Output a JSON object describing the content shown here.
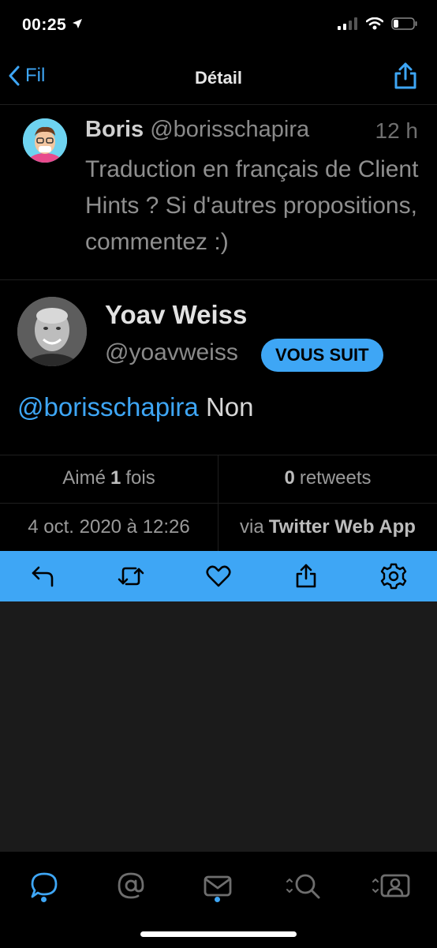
{
  "status": {
    "time": "00:25"
  },
  "nav": {
    "back_label": "Fil",
    "title": "Détail"
  },
  "tweet_parent": {
    "name": "Boris",
    "handle": "@borisschapira",
    "time": "12 h",
    "text": "Traduction en français de Client Hints ? Si d'autres propositions, commentez :)"
  },
  "tweet_main": {
    "name": "Yoav Weiss",
    "handle": "@yoavweiss",
    "badge": "VOUS SUIT",
    "mention": "@borisschapira",
    "text": "Non"
  },
  "stats": {
    "likes_prefix": "Aimé",
    "likes_count": "1",
    "likes_suffix": "fois",
    "retweets_count": "0",
    "retweets_label": "retweets",
    "date": "4 oct. 2020 à 12:26",
    "via_prefix": "via",
    "via_app": "Twitter Web App"
  },
  "colors": {
    "accent": "#3ea6f5",
    "background": "#000000",
    "empty_area": "#1b1b1b"
  },
  "actions": [
    "reply-icon",
    "retweet-icon",
    "heart-icon",
    "share-icon",
    "gear-icon"
  ],
  "tabs": [
    "timeline-tab",
    "mentions-tab",
    "messages-tab",
    "search-tab",
    "profile-tab"
  ]
}
